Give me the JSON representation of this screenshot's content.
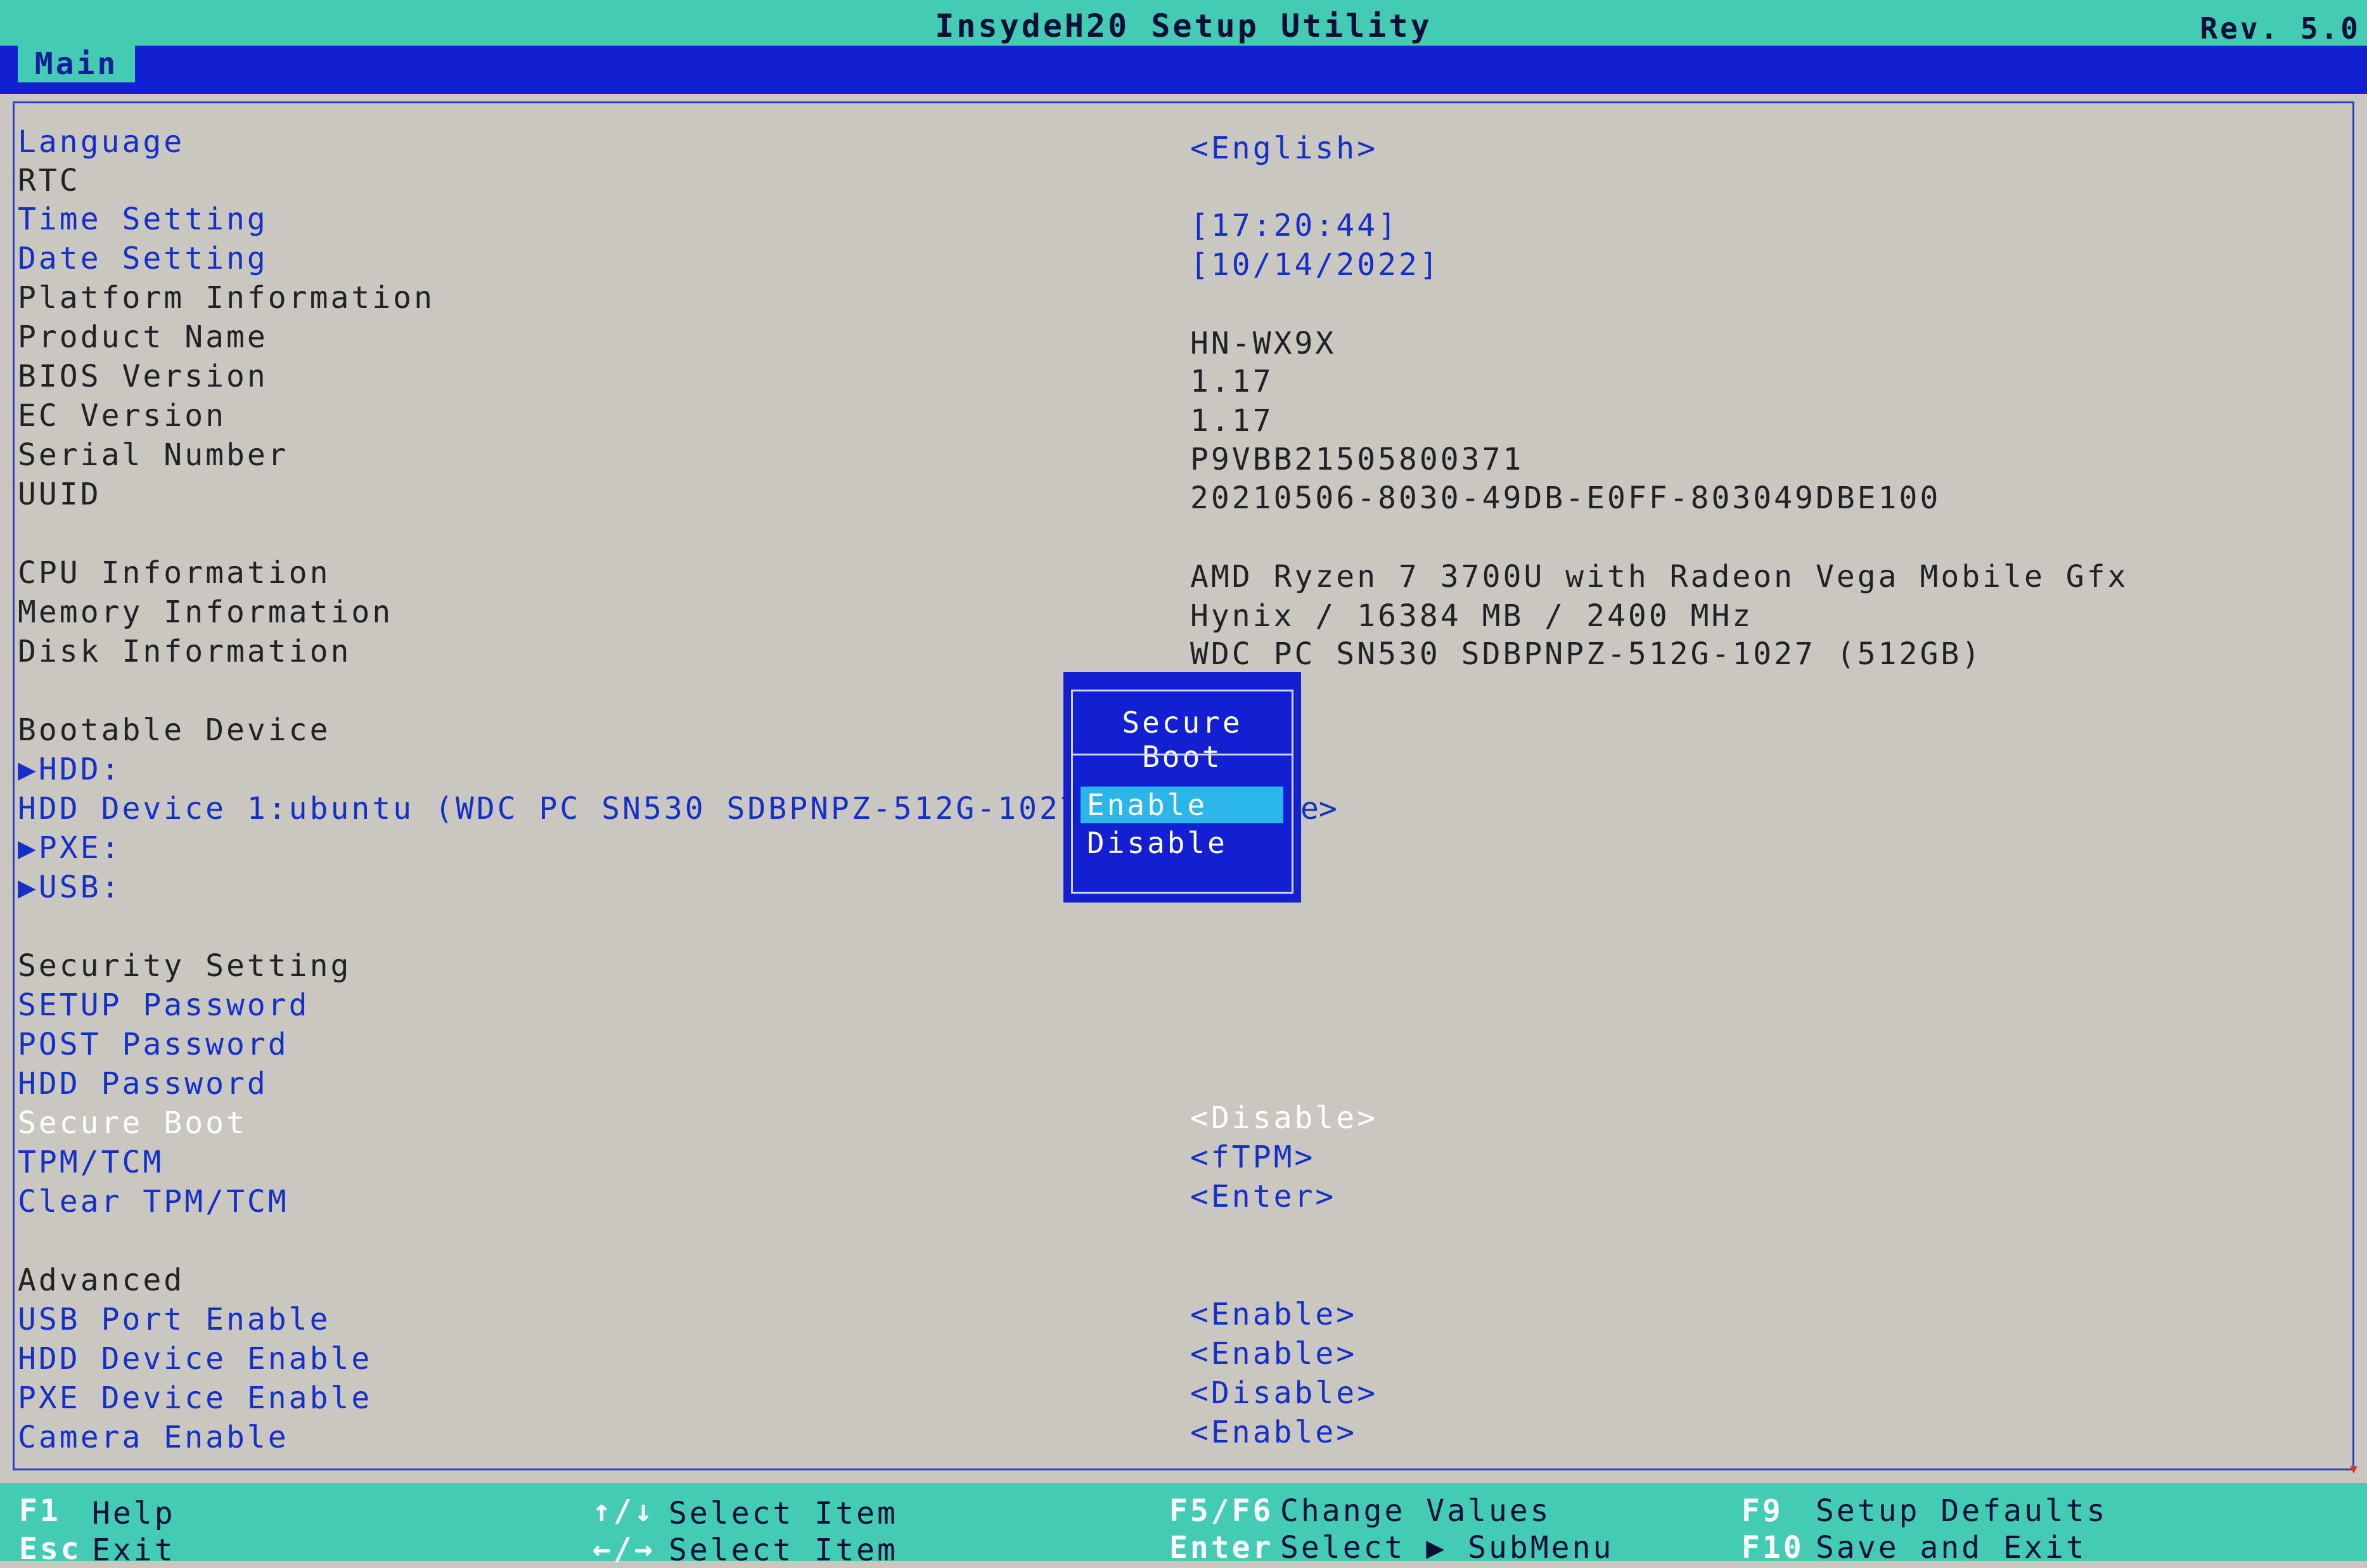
{
  "title": "InsydeH20 Setup Utility",
  "revision": "Rev. 5.0",
  "tabs": [
    {
      "label": "Main"
    }
  ],
  "items": [
    {
      "label": "Language",
      "value": "<English>",
      "kind": "selectable"
    },
    {
      "label": "RTC",
      "value": "",
      "kind": "header"
    },
    {
      "label": "Time Setting",
      "value": "[17:20:44]",
      "kind": "selectable"
    },
    {
      "label": "Date Setting",
      "value": "[10/14/2022]",
      "kind": "selectable"
    },
    {
      "label": "Platform Information",
      "value": "",
      "kind": "header"
    },
    {
      "label": "Product Name",
      "value": "HN-WX9X",
      "kind": "static"
    },
    {
      "label": "BIOS Version",
      "value": "1.17",
      "kind": "static"
    },
    {
      "label": "EC Version",
      "value": "1.17",
      "kind": "static"
    },
    {
      "label": "Serial Number",
      "value": "P9VBB21505800371",
      "kind": "static"
    },
    {
      "label": "UUID",
      "value": "20210506-8030-49DB-E0FF-803049DBE100",
      "kind": "static"
    },
    {
      "label": "CPU Information",
      "value": "AMD Ryzen 7 3700U with Radeon Vega Mobile Gfx",
      "kind": "static"
    },
    {
      "label": "Memory Information",
      "value": "Hynix / 16384 MB / 2400 MHz",
      "kind": "static"
    },
    {
      "label": "Disk Information",
      "value": "WDC PC SN530 SDBPNPZ-512G-1027 (512GB)",
      "kind": "static"
    },
    {
      "label": "Bootable Device",
      "value": "",
      "kind": "header"
    },
    {
      "label": "▶HDD:",
      "value": "",
      "kind": "selectable"
    },
    {
      "label": "HDD Device 1:ubuntu (WDC PC SN530 SDBPNPZ-512G-1027)",
      "value": "",
      "kind": "selectable"
    },
    {
      "label": "▶PXE:",
      "value": "",
      "kind": "selectable"
    },
    {
      "label": "▶USB:",
      "value": "",
      "kind": "selectable"
    },
    {
      "label": "Security Setting",
      "value": "",
      "kind": "header"
    },
    {
      "label": "SETUP Password",
      "value": "",
      "kind": "selectable"
    },
    {
      "label": "POST Password",
      "value": "",
      "kind": "selectable"
    },
    {
      "label": "HDD Password",
      "value": "",
      "kind": "selectable"
    },
    {
      "label": "Secure Boot",
      "value": "<Disable>",
      "kind": "highlighted"
    },
    {
      "label": "TPM/TCM",
      "value": "<fTPM>",
      "kind": "selectable"
    },
    {
      "label": "Clear TPM/TCM",
      "value": "<Enter>",
      "kind": "selectable"
    },
    {
      "label": "Advanced",
      "value": "",
      "kind": "header"
    },
    {
      "label": "USB Port Enable",
      "value": "<Enable>",
      "kind": "selectable"
    },
    {
      "label": "HDD Device Enable",
      "value": "<Enable>",
      "kind": "selectable"
    },
    {
      "label": "PXE Device Enable",
      "value": "<Disable>",
      "kind": "selectable"
    },
    {
      "label": "Camera Enable",
      "value": "<Enable>",
      "kind": "selectable"
    }
  ],
  "popup": {
    "title": "Secure Boot",
    "options": [
      "Enable",
      "Disable"
    ],
    "selected": "Enable",
    "peek_text": "e>"
  },
  "footer": [
    {
      "key": "F1",
      "desc": "Help"
    },
    {
      "key": "↑/↓",
      "desc": "Select Item"
    },
    {
      "key": "F5/F6",
      "desc": "Change Values"
    },
    {
      "key": "F9",
      "desc": "Setup Defaults"
    },
    {
      "key": "Esc",
      "desc": "Exit"
    },
    {
      "key": "←/→",
      "desc": "Select Item"
    },
    {
      "key": "Enter",
      "desc": "Select ▶ SubMenu"
    },
    {
      "key": "F10",
      "desc": "Save and Exit"
    }
  ],
  "colors": {
    "background": "#c9c7c0",
    "accent_teal": "#43cbb3",
    "accent_blue": "#1320d2",
    "selectable_text": "#1530c9",
    "popup_highlight": "#2ab6e8"
  }
}
